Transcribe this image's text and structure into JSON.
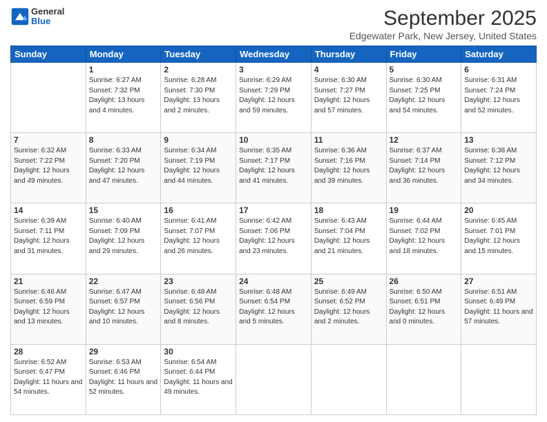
{
  "logo": {
    "general": "General",
    "blue": "Blue"
  },
  "header": {
    "title": "September 2025",
    "subtitle": "Edgewater Park, New Jersey, United States"
  },
  "days": [
    "Sunday",
    "Monday",
    "Tuesday",
    "Wednesday",
    "Thursday",
    "Friday",
    "Saturday"
  ],
  "weeks": [
    [
      {
        "day": "",
        "sunrise": "",
        "sunset": "",
        "daylight": ""
      },
      {
        "day": "1",
        "sunrise": "Sunrise: 6:27 AM",
        "sunset": "Sunset: 7:32 PM",
        "daylight": "Daylight: 13 hours and 4 minutes."
      },
      {
        "day": "2",
        "sunrise": "Sunrise: 6:28 AM",
        "sunset": "Sunset: 7:30 PM",
        "daylight": "Daylight: 13 hours and 2 minutes."
      },
      {
        "day": "3",
        "sunrise": "Sunrise: 6:29 AM",
        "sunset": "Sunset: 7:29 PM",
        "daylight": "Daylight: 12 hours and 59 minutes."
      },
      {
        "day": "4",
        "sunrise": "Sunrise: 6:30 AM",
        "sunset": "Sunset: 7:27 PM",
        "daylight": "Daylight: 12 hours and 57 minutes."
      },
      {
        "day": "5",
        "sunrise": "Sunrise: 6:30 AM",
        "sunset": "Sunset: 7:25 PM",
        "daylight": "Daylight: 12 hours and 54 minutes."
      },
      {
        "day": "6",
        "sunrise": "Sunrise: 6:31 AM",
        "sunset": "Sunset: 7:24 PM",
        "daylight": "Daylight: 12 hours and 52 minutes."
      }
    ],
    [
      {
        "day": "7",
        "sunrise": "Sunrise: 6:32 AM",
        "sunset": "Sunset: 7:22 PM",
        "daylight": "Daylight: 12 hours and 49 minutes."
      },
      {
        "day": "8",
        "sunrise": "Sunrise: 6:33 AM",
        "sunset": "Sunset: 7:20 PM",
        "daylight": "Daylight: 12 hours and 47 minutes."
      },
      {
        "day": "9",
        "sunrise": "Sunrise: 6:34 AM",
        "sunset": "Sunset: 7:19 PM",
        "daylight": "Daylight: 12 hours and 44 minutes."
      },
      {
        "day": "10",
        "sunrise": "Sunrise: 6:35 AM",
        "sunset": "Sunset: 7:17 PM",
        "daylight": "Daylight: 12 hours and 41 minutes."
      },
      {
        "day": "11",
        "sunrise": "Sunrise: 6:36 AM",
        "sunset": "Sunset: 7:16 PM",
        "daylight": "Daylight: 12 hours and 39 minutes."
      },
      {
        "day": "12",
        "sunrise": "Sunrise: 6:37 AM",
        "sunset": "Sunset: 7:14 PM",
        "daylight": "Daylight: 12 hours and 36 minutes."
      },
      {
        "day": "13",
        "sunrise": "Sunrise: 6:38 AM",
        "sunset": "Sunset: 7:12 PM",
        "daylight": "Daylight: 12 hours and 34 minutes."
      }
    ],
    [
      {
        "day": "14",
        "sunrise": "Sunrise: 6:39 AM",
        "sunset": "Sunset: 7:11 PM",
        "daylight": "Daylight: 12 hours and 31 minutes."
      },
      {
        "day": "15",
        "sunrise": "Sunrise: 6:40 AM",
        "sunset": "Sunset: 7:09 PM",
        "daylight": "Daylight: 12 hours and 29 minutes."
      },
      {
        "day": "16",
        "sunrise": "Sunrise: 6:41 AM",
        "sunset": "Sunset: 7:07 PM",
        "daylight": "Daylight: 12 hours and 26 minutes."
      },
      {
        "day": "17",
        "sunrise": "Sunrise: 6:42 AM",
        "sunset": "Sunset: 7:06 PM",
        "daylight": "Daylight: 12 hours and 23 minutes."
      },
      {
        "day": "18",
        "sunrise": "Sunrise: 6:43 AM",
        "sunset": "Sunset: 7:04 PM",
        "daylight": "Daylight: 12 hours and 21 minutes."
      },
      {
        "day": "19",
        "sunrise": "Sunrise: 6:44 AM",
        "sunset": "Sunset: 7:02 PM",
        "daylight": "Daylight: 12 hours and 18 minutes."
      },
      {
        "day": "20",
        "sunrise": "Sunrise: 6:45 AM",
        "sunset": "Sunset: 7:01 PM",
        "daylight": "Daylight: 12 hours and 15 minutes."
      }
    ],
    [
      {
        "day": "21",
        "sunrise": "Sunrise: 6:46 AM",
        "sunset": "Sunset: 6:59 PM",
        "daylight": "Daylight: 12 hours and 13 minutes."
      },
      {
        "day": "22",
        "sunrise": "Sunrise: 6:47 AM",
        "sunset": "Sunset: 6:57 PM",
        "daylight": "Daylight: 12 hours and 10 minutes."
      },
      {
        "day": "23",
        "sunrise": "Sunrise: 6:48 AM",
        "sunset": "Sunset: 6:56 PM",
        "daylight": "Daylight: 12 hours and 8 minutes."
      },
      {
        "day": "24",
        "sunrise": "Sunrise: 6:48 AM",
        "sunset": "Sunset: 6:54 PM",
        "daylight": "Daylight: 12 hours and 5 minutes."
      },
      {
        "day": "25",
        "sunrise": "Sunrise: 6:49 AM",
        "sunset": "Sunset: 6:52 PM",
        "daylight": "Daylight: 12 hours and 2 minutes."
      },
      {
        "day": "26",
        "sunrise": "Sunrise: 6:50 AM",
        "sunset": "Sunset: 6:51 PM",
        "daylight": "Daylight: 12 hours and 0 minutes."
      },
      {
        "day": "27",
        "sunrise": "Sunrise: 6:51 AM",
        "sunset": "Sunset: 6:49 PM",
        "daylight": "Daylight: 11 hours and 57 minutes."
      }
    ],
    [
      {
        "day": "28",
        "sunrise": "Sunrise: 6:52 AM",
        "sunset": "Sunset: 6:47 PM",
        "daylight": "Daylight: 11 hours and 54 minutes."
      },
      {
        "day": "29",
        "sunrise": "Sunrise: 6:53 AM",
        "sunset": "Sunset: 6:46 PM",
        "daylight": "Daylight: 11 hours and 52 minutes."
      },
      {
        "day": "30",
        "sunrise": "Sunrise: 6:54 AM",
        "sunset": "Sunset: 6:44 PM",
        "daylight": "Daylight: 11 hours and 49 minutes."
      },
      {
        "day": "",
        "sunrise": "",
        "sunset": "",
        "daylight": ""
      },
      {
        "day": "",
        "sunrise": "",
        "sunset": "",
        "daylight": ""
      },
      {
        "day": "",
        "sunrise": "",
        "sunset": "",
        "daylight": ""
      },
      {
        "day": "",
        "sunrise": "",
        "sunset": "",
        "daylight": ""
      }
    ]
  ]
}
